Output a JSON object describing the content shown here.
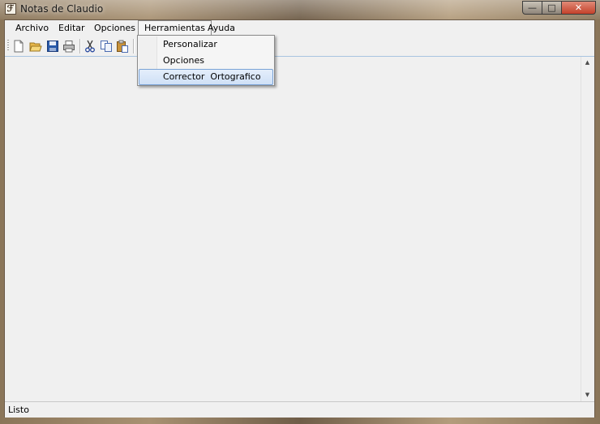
{
  "window": {
    "title": "Notas de Claudio",
    "app_icon": "quill-icon",
    "controls": {
      "minimize": "—",
      "maximize": "□",
      "close": "✕"
    }
  },
  "menubar": {
    "items": [
      {
        "label": "Archivo"
      },
      {
        "label": "Editar"
      },
      {
        "label": "Opciones"
      },
      {
        "label": "Herramientas"
      },
      {
        "label": "Ayuda"
      }
    ],
    "open_menu": "Herramientas"
  },
  "toolbar": {
    "buttons": [
      "new-file-icon",
      "open-folder-icon",
      "save-icon",
      "print-icon",
      "cut-icon",
      "copy-icon",
      "paste-icon"
    ]
  },
  "dropdown": {
    "items": [
      {
        "label": "Personalizar"
      },
      {
        "label": "Opciones"
      },
      {
        "label": "Corrector  Ortografico",
        "highlighted": true
      }
    ],
    "highlight_color": "#cfe0f6"
  },
  "statusbar": {
    "text": "Listo"
  },
  "colors": {
    "client_bg": "#f0f0f0",
    "close_button": "#c4412a"
  }
}
